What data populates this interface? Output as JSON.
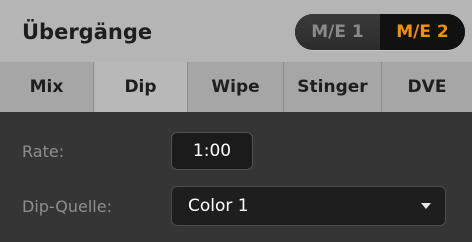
{
  "header": {
    "title": "Übergänge",
    "me_buttons": [
      {
        "label": "M/E 1",
        "active": false
      },
      {
        "label": "M/E 2",
        "active": true
      }
    ],
    "active_color": "#f39200"
  },
  "tabs": [
    {
      "label": "Mix"
    },
    {
      "label": "Dip",
      "selected": true
    },
    {
      "label": "Wipe"
    },
    {
      "label": "Stinger"
    },
    {
      "label": "DVE"
    }
  ],
  "fields": {
    "rate": {
      "label": "Rate:",
      "value": "1:00"
    },
    "dip_source": {
      "label": "Dip-Quelle:",
      "value": "Color 1",
      "icon": "chevron-down-icon"
    }
  }
}
